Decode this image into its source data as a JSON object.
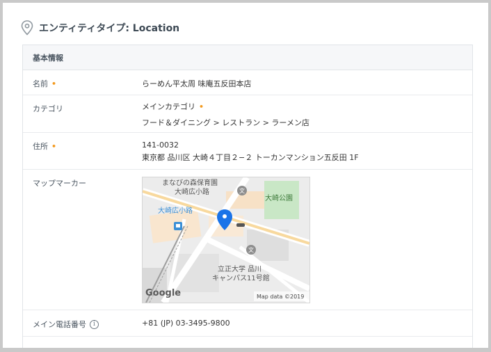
{
  "entity": {
    "title": "エンティティタイプ: Location",
    "section_title": "基本情報"
  },
  "fields": {
    "name": {
      "label": "名前",
      "value": "らーめん平太周 味庵五反田本店"
    },
    "category": {
      "label": "カテゴリ",
      "main_label": "メインカテゴリ",
      "value": "フード＆ダイニング > レストラン > ラーメン店"
    },
    "address": {
      "label": "住所",
      "postal": "141-0032",
      "line": "東京都 品川区 大崎４丁目２−２ トーカンマンション五反田 1F"
    },
    "map_marker": {
      "label": "マップマーカー",
      "places": {
        "nursery": "まなびの森保育園",
        "nursery2": "大崎広小路",
        "park": "大崎公園",
        "station": "大崎広小路",
        "univ1": "立正大学 品川",
        "univ2": "キャンパス11号館"
      },
      "google_logo": "Google",
      "attribution": "Map data ©2019"
    },
    "phone": {
      "label": "メイン電話番号",
      "value": "+81 (JP) 03-3495-9800",
      "info_icon": "i"
    }
  },
  "colors": {
    "required": "#f39a1f",
    "map_marker": "#1a73e8",
    "station_text": "#3b8fd6"
  }
}
